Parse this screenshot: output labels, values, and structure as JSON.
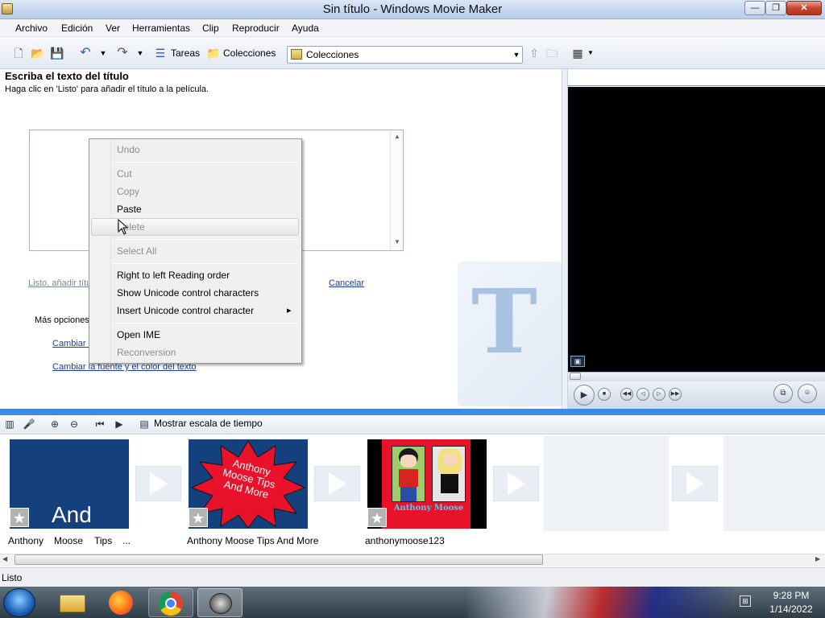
{
  "window": {
    "title": "Sin título - Windows Movie Maker"
  },
  "menubar": {
    "items": [
      "Archivo",
      "Edición",
      "Ver",
      "Herramientas",
      "Clip",
      "Reproducir",
      "Ayuda"
    ]
  },
  "toolbar": {
    "tasks_label": "Tareas",
    "collections_label": "Colecciones",
    "collections_select": "Colecciones"
  },
  "task_pane": {
    "title": "Escriba el texto del título",
    "subtitle": "Haga clic en 'Listo' para añadir el título a la película.",
    "done_link": "Listo, añadir títu",
    "cancel_link": "Cancelar",
    "more_options": "Más opciones:",
    "change_animation_link": "Cambiar l",
    "change_font_link": "Cambiar la fuente y el color del texto"
  },
  "context_menu": {
    "items": [
      {
        "label": "Undo",
        "enabled": false
      },
      {
        "label": "Cut",
        "enabled": false
      },
      {
        "label": "Copy",
        "enabled": false
      },
      {
        "label": "Paste",
        "enabled": true
      },
      {
        "label": "Delete",
        "enabled": false
      },
      {
        "label": "Select All",
        "enabled": false
      },
      {
        "label": "Right to left Reading order",
        "enabled": true
      },
      {
        "label": "Show Unicode control characters",
        "enabled": true
      },
      {
        "label": "Insert Unicode control character",
        "enabled": true,
        "submenu_arrow": "▸"
      },
      {
        "label": "Open IME",
        "enabled": true
      },
      {
        "label": "Reconversion",
        "enabled": false
      }
    ]
  },
  "storyboard_toolbar": {
    "show_timeline": "Mostrar escala de tiempo"
  },
  "storyboard": {
    "clips": [
      {
        "thumb_text": "And",
        "label_words": [
          "Anthony",
          "Moose",
          "Tips",
          "..."
        ]
      },
      {
        "thumb_text": "Anthony Moose Tips And More",
        "label": "Anthony Moose Tips And More"
      },
      {
        "thumb_text": "Anthony Moose",
        "label": "anthonymoose123"
      }
    ]
  },
  "statusbar": {
    "text": "Listo"
  },
  "taskbar": {
    "time": "9:28 PM",
    "date": "1/14/2022"
  },
  "colors": {
    "accent_blue": "#3e8ae6",
    "link": "#1a3da8",
    "clip_blue": "#15407e",
    "clip_red": "#e8122a"
  }
}
